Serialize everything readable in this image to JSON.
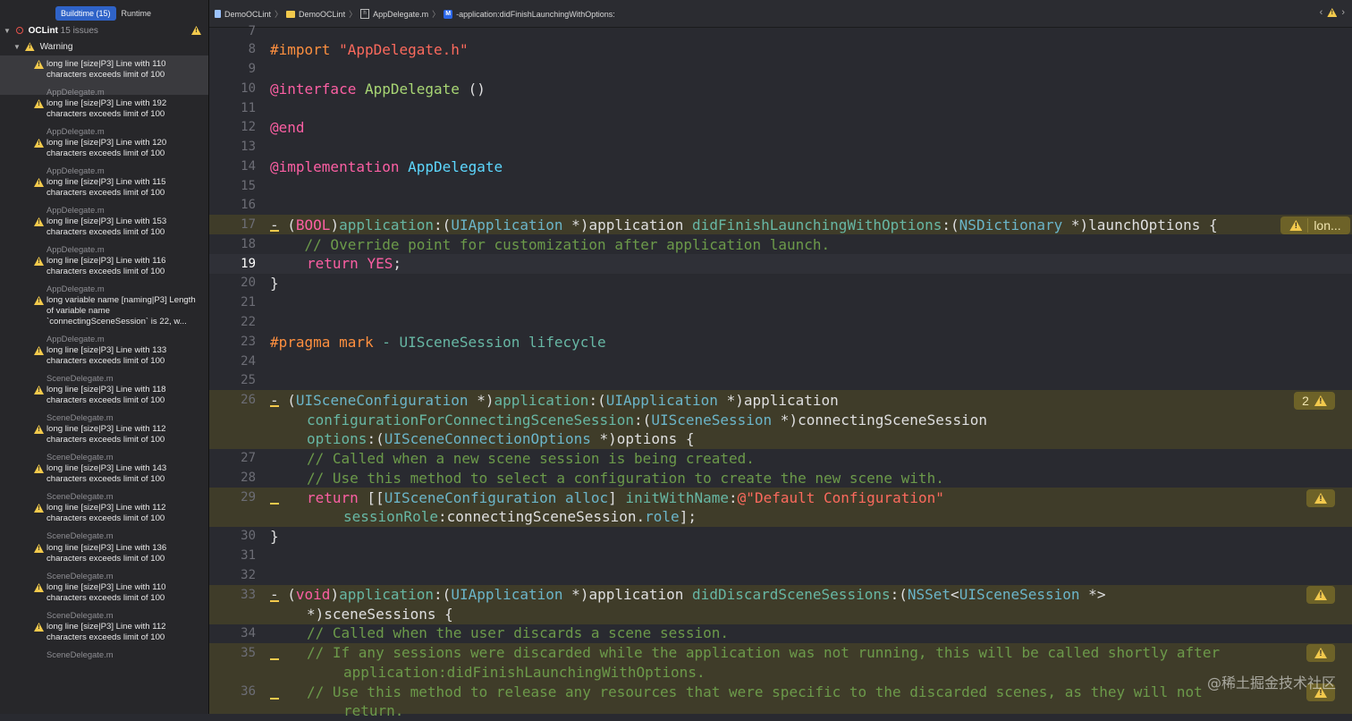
{
  "navigator": {
    "tab_buildtime": "Buildtime (15)",
    "tab_runtime": "Runtime",
    "group_name": "OCLint",
    "group_count": "15 issues",
    "subgroup": "Warning",
    "issues": [
      {
        "msg": "long line [size|P3] Line with 110 characters exceeds limit of 100",
        "file": "AppDelegate.m"
      },
      {
        "msg": "long line [size|P3] Line with 192 characters exceeds limit of 100",
        "file": "AppDelegate.m"
      },
      {
        "msg": "long line [size|P3] Line with 120 characters exceeds limit of 100",
        "file": "AppDelegate.m"
      },
      {
        "msg": "long line [size|P3] Line with 115 characters exceeds limit of 100",
        "file": "AppDelegate.m"
      },
      {
        "msg": "long line [size|P3] Line with 153 characters exceeds limit of 100",
        "file": "AppDelegate.m"
      },
      {
        "msg": "long line [size|P3] Line with 116 characters exceeds limit of 100",
        "file": "AppDelegate.m"
      },
      {
        "msg": "long variable name [naming|P3] Length of variable name `connectingSceneSession` is 22, w...",
        "file": "AppDelegate.m"
      },
      {
        "msg": "long line [size|P3] Line with 133 characters exceeds limit of 100",
        "file": "SceneDelegate.m"
      },
      {
        "msg": "long line [size|P3] Line with 118 characters exceeds limit of 100",
        "file": "SceneDelegate.m"
      },
      {
        "msg": "long line [size|P3] Line with 112 characters exceeds limit of 100",
        "file": "SceneDelegate.m"
      },
      {
        "msg": "long line [size|P3] Line with 143 characters exceeds limit of 100",
        "file": "SceneDelegate.m"
      },
      {
        "msg": "long line [size|P3] Line with 112 characters exceeds limit of 100",
        "file": "SceneDelegate.m"
      },
      {
        "msg": "long line [size|P3] Line with 136 characters exceeds limit of 100",
        "file": "SceneDelegate.m"
      },
      {
        "msg": "long line [size|P3] Line with 110 characters exceeds limit of 100",
        "file": "SceneDelegate.m"
      },
      {
        "msg": "long line [size|P3] Line with 112 characters exceeds limit of 100",
        "file": "SceneDelegate.m"
      }
    ]
  },
  "jumpbar": {
    "crumb1": "DemoOCLint",
    "crumb2": "DemoOCLint",
    "crumb3": "AppDelegate.m",
    "crumb4": "-application:didFinishLaunchingWithOptions:",
    "m_badge": "M",
    "h_badge": "h"
  },
  "editor": {
    "line_numbers": [
      "7",
      "8",
      "9",
      "10",
      "11",
      "12",
      "13",
      "14",
      "15",
      "16",
      "17",
      "18",
      "19",
      "20",
      "21",
      "22",
      "23",
      "24",
      "25",
      "26",
      "27",
      "28",
      "29",
      "30",
      "31",
      "32",
      "33",
      "34",
      "35",
      "36"
    ],
    "badge_17_text": "lon...",
    "badge_26_count": "2",
    "line8_import": "#import",
    "line8_str": "\"AppDelegate.h\"",
    "line10_kw": "@interface",
    "line10_cls": "AppDelegate",
    "line10_rest": " ()",
    "line12": "@end",
    "line14_kw": "@implementation",
    "line14_cls": "AppDelegate",
    "line17": [
      "- (",
      "BOOL",
      ")",
      "application",
      ":(",
      "UIApplication",
      " *)application ",
      "didFinishLaunchingWithOptions",
      ":(",
      "NSDictionary",
      " *)launchOptions {"
    ],
    "line18": "    // Override point for customization after application launch.",
    "line19_kw": "return",
    "line19_val": "YES",
    "line19_end": ";",
    "line20": "}",
    "line23_pragma": "#pragma mark",
    "line23_rest": " - UISceneSession lifecycle",
    "line26a": [
      "- (",
      "UISceneConfiguration",
      " *)",
      "application",
      ":(",
      "UIApplication",
      " *)application"
    ],
    "line26b": [
      "configurationForConnectingSceneSession",
      ":(",
      "UISceneSession",
      " *)connectingSceneSession"
    ],
    "line26c": [
      "options",
      ":(",
      "UISceneConnectionOptions",
      " *)options {"
    ],
    "line27": "// Called when a new scene session is being created.",
    "line28": "// Use this method to select a configuration to create the new scene with.",
    "line29a": [
      "return",
      " [[",
      "UISceneConfiguration",
      " ",
      "alloc",
      "] ",
      "initWithName",
      ":",
      "@\"Default Configuration\""
    ],
    "line29b": [
      "sessionRole",
      ":connectingSceneSession.",
      "role",
      "];"
    ],
    "line30": "}",
    "line33a": [
      "- (",
      "void",
      ")",
      "application",
      ":(",
      "UIApplication",
      " *)application ",
      "didDiscardSceneSessions",
      ":(",
      "NSSet",
      "<",
      "UISceneSession",
      " *>"
    ],
    "line33b": "*)sceneSessions {",
    "line34": "// Called when the user discards a scene session.",
    "line35a": "// If any sessions were discarded while the application was not running, this will be called shortly after",
    "line35b": "application:didFinishLaunchingWithOptions.",
    "line36a": "// Use this method to release any resources that were specific to the discarded scenes, as they will not",
    "line36b": "return."
  },
  "watermark": "@稀土掘金技术社区"
}
